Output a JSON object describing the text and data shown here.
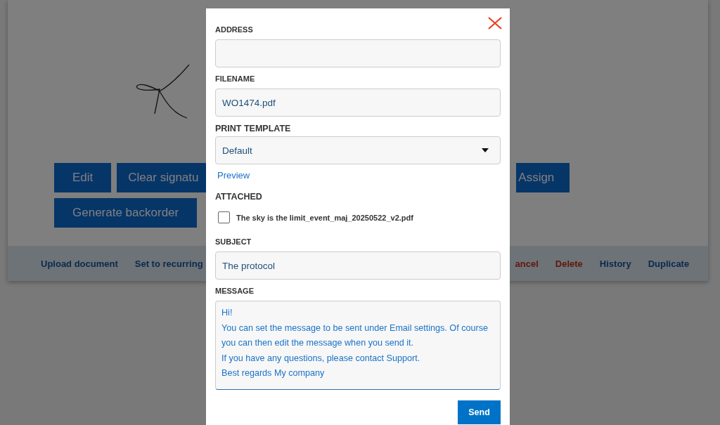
{
  "page": {
    "buttons_row_1": [
      {
        "label": "Edit",
        "kind": "full"
      },
      {
        "label": "Clear signatu",
        "kind": "cut_left"
      },
      {
        "label": "Assign",
        "kind": "cut_right"
      }
    ],
    "buttons_row_2": [
      {
        "label": "Generate backorder",
        "kind": "full"
      }
    ],
    "actions_left": [
      {
        "label": "Upload document",
        "danger": false
      },
      {
        "label": "Set to recurring",
        "danger": false
      }
    ],
    "actions_right": [
      {
        "label": "ancel",
        "danger": true
      },
      {
        "label": "Delete",
        "danger": true
      },
      {
        "label": "History",
        "danger": false
      },
      {
        "label": "Duplicate",
        "danger": false
      }
    ]
  },
  "dialog": {
    "address": {
      "label": "ADDRESS"
    },
    "filename": {
      "label": "FILENAME",
      "value": "WO1474.pdf"
    },
    "print_template": {
      "label": "PRINT TEMPLATE",
      "value": "Default"
    },
    "preview_link": "Preview",
    "attached": {
      "label": "ATTACHED",
      "files": [
        {
          "name": "The sky is the limit_event_maj_20250522_v2.pdf",
          "checked": false
        }
      ]
    },
    "subject": {
      "label": "SUBJECT",
      "value": "The protocol"
    },
    "message": {
      "label": "MESSAGE",
      "value": "Hi!\nYou can set the message to be sent under Email settings. Of course you can then edit the message when you send it.\nIf you have any questions, please contact Support.\nBest regards My company"
    },
    "send_button": "Send"
  }
}
